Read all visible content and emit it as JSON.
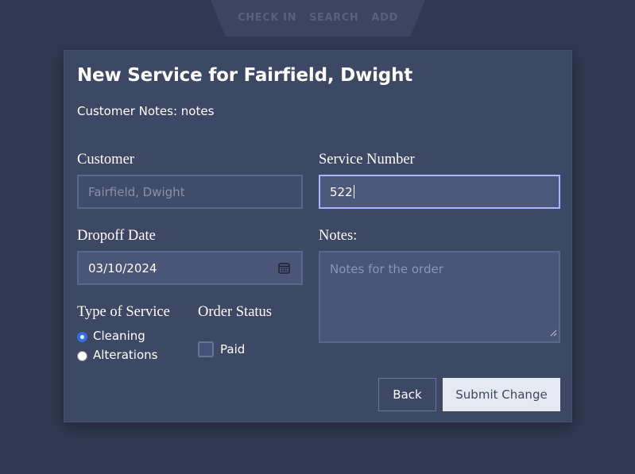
{
  "nav": {
    "items": [
      "CHECK IN",
      "SEARCH",
      "ADD"
    ]
  },
  "form": {
    "title": "New Service for Fairfield, Dwight",
    "customer_notes": "Customer Notes: notes",
    "customer_label": "Customer",
    "customer_value": "Fairfield, Dwight",
    "service_number_label": "Service Number",
    "service_number_value": "522",
    "dropoff_label": "Dropoff Date",
    "dropoff_value": "03/10/2024",
    "notes_label": "Notes:",
    "notes_placeholder": "Notes for the order",
    "type_label": "Type of Service",
    "type_options": [
      "Cleaning",
      "Alterations"
    ],
    "type_selected": "Cleaning",
    "status_label": "Order Status",
    "paid_label": "Paid",
    "paid_checked": false,
    "back_label": "Back",
    "submit_label": "Submit Change"
  },
  "icons": {
    "date_picker": "calendar-icon",
    "textarea_resize": "resize-grip-icon"
  },
  "colors": {
    "background": "#2f3a52",
    "card": "#3d4864",
    "focus_border": "#a9b5ff",
    "radio_selected": "#2f6fe0"
  }
}
